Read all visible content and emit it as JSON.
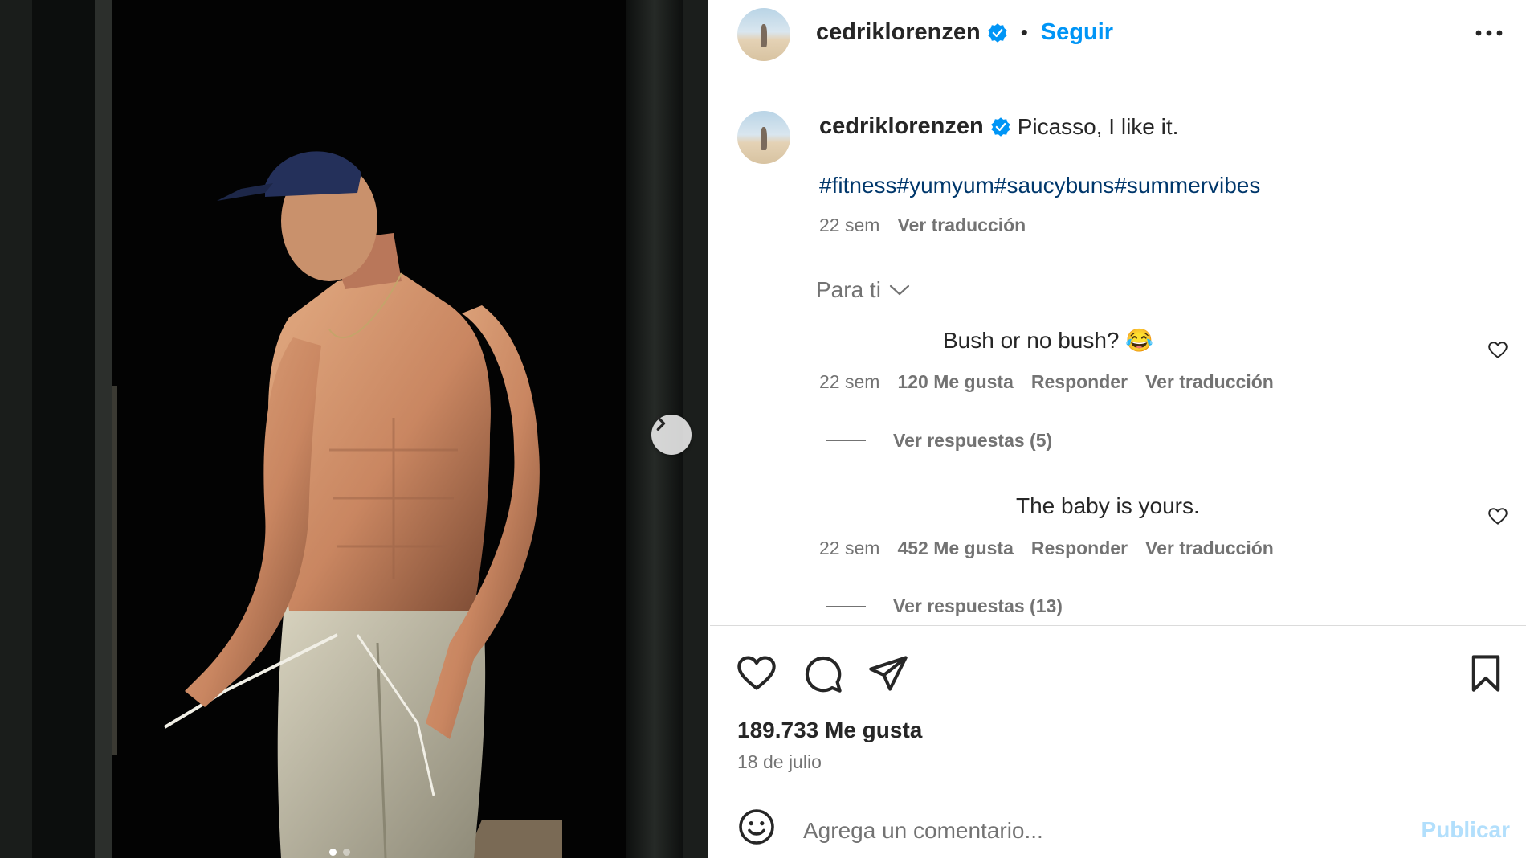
{
  "post": {
    "username": "cedriklorenzen",
    "follow_label": "Seguir",
    "separator": "•"
  },
  "caption": {
    "username": "cedriklorenzen",
    "text": "Picasso, I like it.",
    "hashtags": [
      "#fitness",
      "#yumyum",
      "#saucybuns",
      "#summervibes"
    ],
    "age": "22 sem",
    "translate": "Ver traducción"
  },
  "filter": {
    "label": "Para ti"
  },
  "comments": [
    {
      "text": "Bush or no bush? 😂",
      "age": "22 sem",
      "likes": "120 Me gusta",
      "reply": "Responder",
      "translate": "Ver traducción",
      "replies": "Ver respuestas (5)"
    },
    {
      "text": "The baby is yours.",
      "age": "22 sem",
      "likes": "452 Me gusta",
      "reply": "Responder",
      "translate": "Ver traducción",
      "replies": "Ver respuestas (13)"
    }
  ],
  "stats": {
    "likes": "189.733 Me gusta",
    "date": "18 de julio"
  },
  "composer": {
    "placeholder": "Agrega un comentario...",
    "publish": "Publicar"
  },
  "carousel": {
    "slide": 1,
    "total": 2
  },
  "icons": {
    "next": "chevron-right-icon",
    "verified": "verified-badge-icon",
    "more": "more-horizontal-icon",
    "like": "heart-icon",
    "comment": "comment-bubble-icon",
    "share": "paper-plane-icon",
    "save": "bookmark-icon",
    "emoji": "emoji-smile-icon",
    "filter": "chevron-down-icon"
  },
  "colors": {
    "follow": "#0095f6",
    "hashtag": "#00376b",
    "verified": "#0095f6",
    "publish_disabled": "#b2dffc",
    "muted": "#737373"
  }
}
